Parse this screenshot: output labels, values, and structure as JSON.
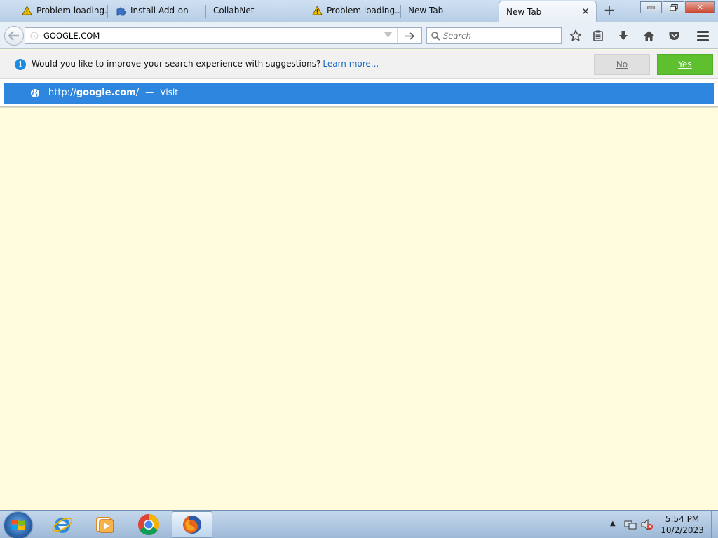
{
  "tabs": [
    {
      "label": "Problem loading...",
      "icon": "warning-icon"
    },
    {
      "label": "Install Add-on",
      "icon": "puzzle-icon"
    },
    {
      "label": "CollabNet",
      "icon": ""
    },
    {
      "label": "Problem loading...",
      "icon": "warning-icon"
    },
    {
      "label": "New Tab",
      "icon": ""
    },
    {
      "label": "New Tab",
      "icon": "",
      "active": true
    }
  ],
  "url_bar": {
    "value": "GOOGLE.COM"
  },
  "search_bar": {
    "placeholder": "Search"
  },
  "notification": {
    "message": "Would you like to improve your search experience with suggestions?",
    "link": "Learn more...",
    "no_label": "No",
    "yes_label": "Yes"
  },
  "suggestion": {
    "url_prefix": "http://",
    "url_host": "google.com",
    "url_suffix": "/",
    "separator": "—",
    "action": "Visit"
  },
  "taskbar": {
    "apps": [
      "internet-explorer-icon",
      "media-player-icon",
      "chrome-icon",
      "firefox-icon"
    ],
    "time": "5:54 PM",
    "date": "10/2/2023"
  },
  "colors": {
    "page_background": "#fffbdc",
    "suggestion_highlight": "#2f86de",
    "yes_button": "#5ec02f"
  }
}
